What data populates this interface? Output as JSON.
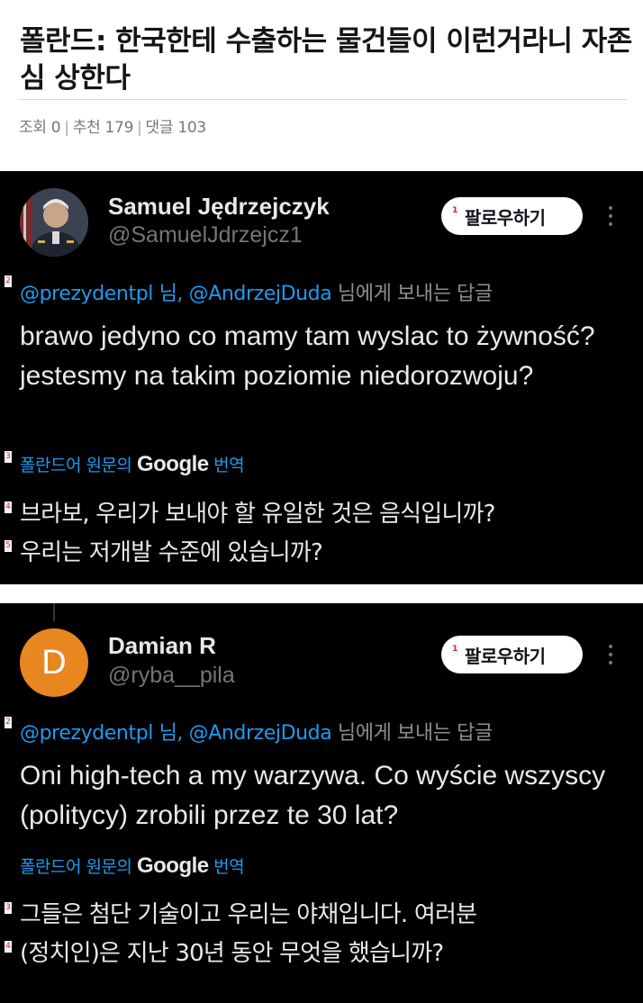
{
  "post": {
    "title": "폴란드: 한국한테 수출하는 물건들이 이런거라니 자존심 상한다",
    "views_label": "조회 0",
    "likes_label": "추천 179",
    "comments_label": "댓글 103"
  },
  "tweets": [
    {
      "author_name": "Samuel Jędrzejczyk",
      "handle": "@SamuelJdrzejcz1",
      "follow_label": "팔로우하기",
      "reply_mentions": "@prezydentpl 님, @AndrzejDuda",
      "reply_suffix": " 님에게 보내는 답글",
      "text": "brawo jedyno co mamy tam wyslac to żywność?  jestesmy na takim poziomie niedorozwoju?",
      "translate_prefix": "폴란드어 원문의 ",
      "translate_brand": "Google",
      "translate_suffix": " 번역",
      "translation_line_1": "브라보, 우리가 보내야 할 유일한 것은 음식입니까?",
      "translation_line_2": "우리는 저개발 수준에 있습니까?"
    },
    {
      "author_name": "Damian R",
      "avatar_letter": "D",
      "handle": "@ryba__pila",
      "follow_label": "팔로우하기",
      "reply_mentions": "@prezydentpl 님, @AndrzejDuda",
      "reply_suffix": " 님에게 보내는 답글",
      "text": "Oni high-tech a my warzywa. Co wyście wszyscy (politycy) zrobili przez te 30 lat?",
      "translate_prefix": "폴란드어 원문의 ",
      "translate_brand": "Google",
      "translate_suffix": " 번역",
      "translation_line_1": "그들은 첨단 기술이고 우리는 야채입니다. 여러분",
      "translation_line_2": "(정치인)은 지난 30년 동안 무엇을 했습니까?"
    }
  ],
  "markers": [
    "1",
    "2",
    "3",
    "4",
    "5"
  ],
  "colors": {
    "link_blue": "#1d9bf0",
    "card_bg": "#000000",
    "muted_gray": "#71767b",
    "avatar_orange": "#e8861f",
    "marker_red": "#dd2222"
  }
}
